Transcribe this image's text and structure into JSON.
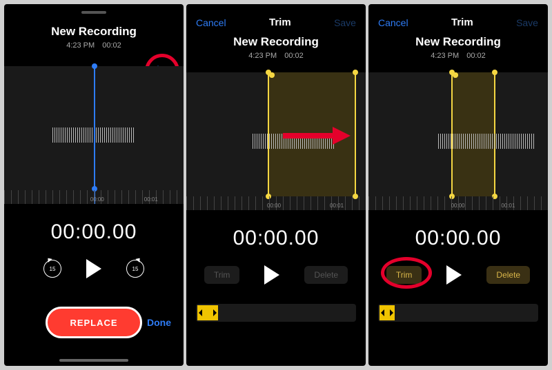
{
  "colors": {
    "accent_blue": "#2e7cf6",
    "accent_red": "#ff3b30",
    "highlight": "#e4002b",
    "trim_yellow": "#f5d742"
  },
  "panel1": {
    "title": "New Recording",
    "time": "4:23 PM",
    "duration": "00:02",
    "timer": "00:00.00",
    "skip_back_label": "15",
    "skip_fwd_label": "15",
    "ruler": {
      "t0": "00:00",
      "t1": "00:01"
    },
    "replace_label": "REPLACE",
    "done_label": "Done",
    "crop_icon": "crop-icon"
  },
  "panel2": {
    "nav": {
      "cancel": "Cancel",
      "title": "Trim",
      "save": "Save"
    },
    "title": "New Recording",
    "time": "4:23 PM",
    "duration": "00:02",
    "timer": "00:00.00",
    "ruler": {
      "t0": "00:00",
      "t1": "00:01"
    },
    "trim_label": "Trim",
    "delete_label": "Delete"
  },
  "panel3": {
    "nav": {
      "cancel": "Cancel",
      "title": "Trim",
      "save": "Save"
    },
    "title": "New Recording",
    "time": "4:23 PM",
    "duration": "00:02",
    "timer": "00:00.00",
    "ruler": {
      "t0": "00:00",
      "t1": "00:01"
    },
    "trim_label": "Trim",
    "delete_label": "Delete"
  }
}
